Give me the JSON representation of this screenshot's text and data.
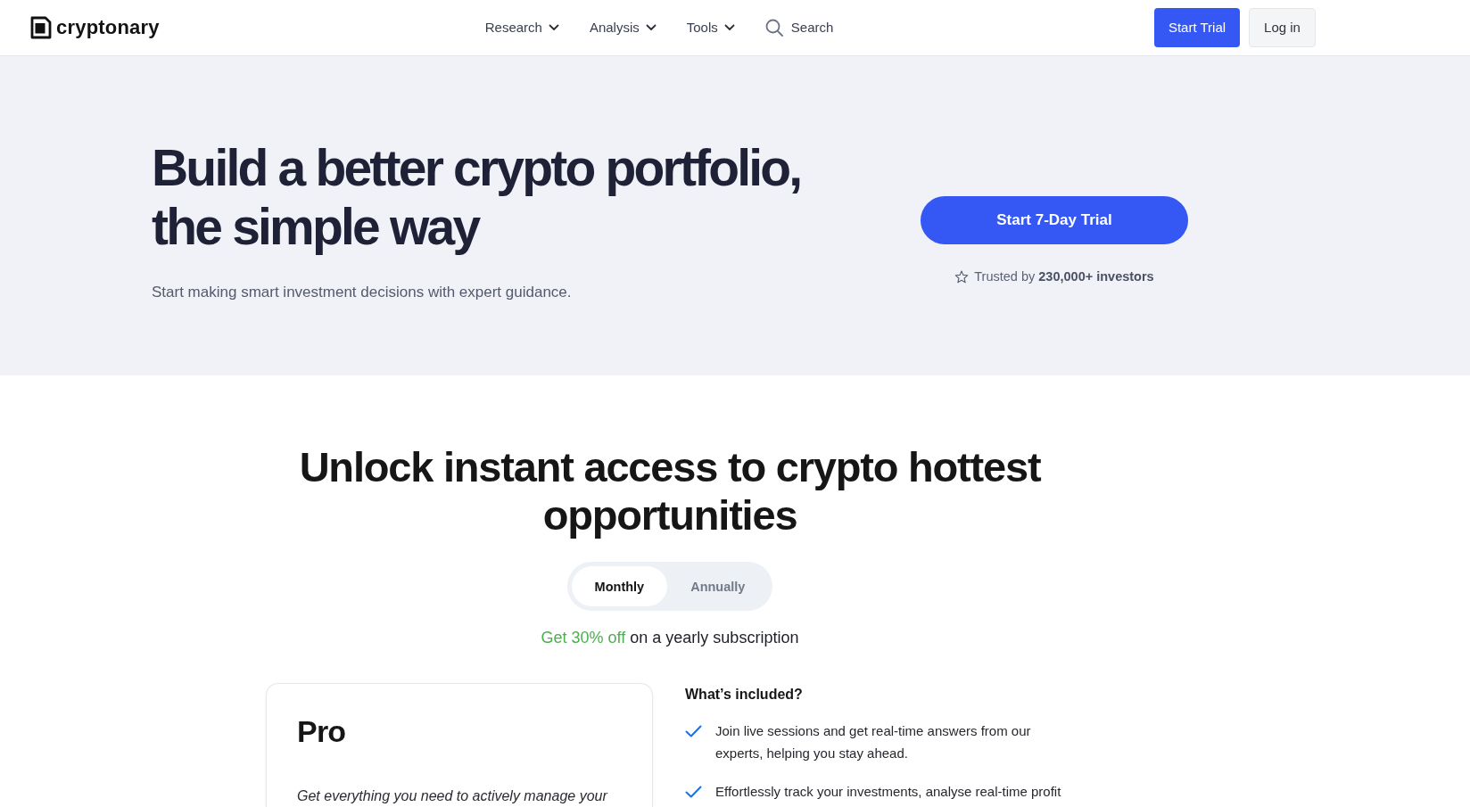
{
  "nav": {
    "logo": "cryptonary",
    "menu": [
      {
        "label": "Research",
        "kind": "dropdown"
      },
      {
        "label": "Analysis",
        "kind": "dropdown"
      },
      {
        "label": "Tools",
        "kind": "dropdown"
      },
      {
        "label": "Search",
        "kind": "search"
      }
    ],
    "buttons": [
      {
        "label": "Start Trial",
        "kind": "primary"
      },
      {
        "label": "Log in",
        "kind": "secondary"
      }
    ]
  },
  "hero": {
    "title": "Build a better crypto portfolio, the simple way",
    "subtitle": "Start making smart investment decisions with expert guidance.",
    "cta": "Start 7-Day Trial",
    "trust": "Trusted by **230,000+ investors**"
  },
  "pricing": {
    "title": "Unlock instant access to crypto hottest opportunities",
    "billing_tabs": [
      {
        "label": "Monthly",
        "selected": true
      },
      {
        "label": "Annually",
        "selected": false
      }
    ],
    "discount": {
      "highlight": "Get 30% off",
      "text": "on a yearly subscription"
    },
    "plan": {
      "name": "Pro",
      "description": "Get everything you need to actively manage your"
    },
    "included": {
      "title": "What’s included?",
      "items": [
        "Join live sessions and get real-time answers from our experts, helping you stay ahead.",
        "Effortlessly track your investments, analyse real-time profit"
      ]
    }
  }
}
